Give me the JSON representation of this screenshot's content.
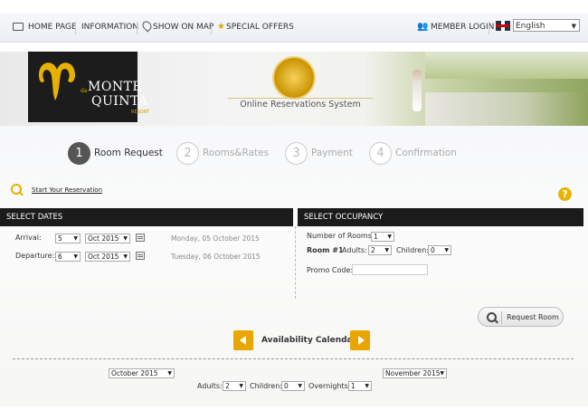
{
  "nav": {
    "home": "HOME PAGE",
    "information": "INFORMATION",
    "show_on_map": "SHOW ON MAP",
    "special_offers": "SPECIAL OFFERS",
    "member_login": "MEMBER LOGIN",
    "language": "English"
  },
  "banner": {
    "logo_line1": "MONTE",
    "logo_de": "da",
    "logo_line2": "QUINTA",
    "logo_resort": "RESORT",
    "subtitle": "Online Reservations System"
  },
  "steps": [
    {
      "num": "1",
      "label": "Room Request"
    },
    {
      "num": "2",
      "label": "Rooms&Rates"
    },
    {
      "num": "3",
      "label": "Payment"
    },
    {
      "num": "4",
      "label": "Confirmation"
    }
  ],
  "start_link": "Start Your Reservation",
  "help_icon": "?",
  "dates": {
    "header": "SELECT DATES",
    "arrival_label": "Arrival:",
    "arrival_day": "5",
    "arrival_month": "Oct 2015",
    "arrival_text": "Monday, 05 October 2015",
    "departure_label": "Departure:",
    "departure_day": "6",
    "departure_month": "Oct 2015",
    "departure_text": "Tuesday, 06 October 2015"
  },
  "occupancy": {
    "header": "SELECT OCCUPANCY",
    "rooms_label": "Number of Rooms:",
    "rooms_value": "1",
    "room1_label": "Room #1",
    "adults_label": "Adults:",
    "adults_value": "2",
    "children_label": "Children:",
    "children_value": "0",
    "promo_label": "Promo Code:",
    "promo_value": ""
  },
  "request_button": "Request Room",
  "availability": {
    "title": "Availability Calendar",
    "month_left": "October 2015",
    "month_right": "November 2015",
    "adults_label": "Adults:",
    "adults_value": "2",
    "children_label": "Children:",
    "children_value": "0",
    "overnights_label": "Overnights:",
    "overnights_value": "1"
  },
  "dropdown_arrow": "▼"
}
